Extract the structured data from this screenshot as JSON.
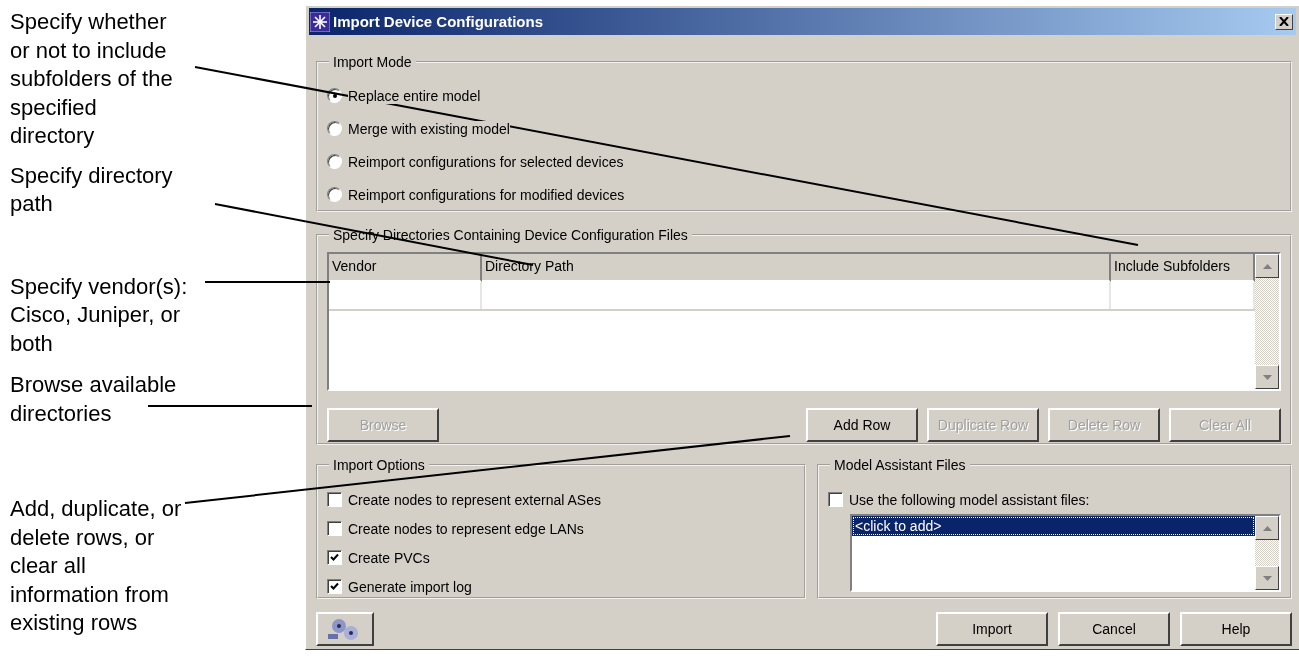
{
  "annotations": [
    {
      "text": "Specify whether\nor not to include\nsubfolders of the\nspecified\ndirectory"
    },
    {
      "text": "Specify directory\npath"
    },
    {
      "text": "Specify vendor(s):\nCisco, Juniper, or\nboth"
    },
    {
      "text": "Browse available\ndirectories"
    },
    {
      "text": "Add, duplicate, or\ndelete rows, or\nclear all\ninformation from\nexisting rows"
    }
  ],
  "window": {
    "title": "Import Device Configurations"
  },
  "import_mode": {
    "legend": "Import Mode",
    "options": [
      {
        "label": "Replace entire model",
        "selected": true
      },
      {
        "label": "Merge with existing model",
        "selected": false
      },
      {
        "label": "Reimport configurations for selected devices",
        "selected": false
      },
      {
        "label": "Reimport configurations for modified devices",
        "selected": false
      }
    ]
  },
  "directories": {
    "legend": "Specify Directories Containing Device Configuration Files",
    "columns": [
      "Vendor",
      "Directory Path",
      "Include Subfolders"
    ],
    "browse_button": {
      "label": "Browse",
      "disabled": true
    },
    "row_buttons": [
      {
        "label": "Add Row",
        "disabled": false
      },
      {
        "label": "Duplicate Row",
        "disabled": true
      },
      {
        "label": "Delete Row",
        "disabled": true
      },
      {
        "label": "Clear All",
        "disabled": true
      }
    ]
  },
  "import_options": {
    "legend": "Import Options",
    "options": [
      {
        "label": "Create nodes to represent external ASes",
        "checked": false
      },
      {
        "label": "Create nodes to represent edge LANs",
        "checked": false
      },
      {
        "label": "Create PVCs",
        "checked": true
      },
      {
        "label": "Generate import log",
        "checked": true
      }
    ]
  },
  "model_assistant": {
    "legend": "Model Assistant Files",
    "checkbox": {
      "label": "Use the following model assistant files:",
      "checked": false
    },
    "files": [
      {
        "label": "<click to add>",
        "selected": true
      }
    ]
  },
  "footer_buttons": [
    {
      "label": "Import"
    },
    {
      "label": "Cancel"
    },
    {
      "label": "Help"
    }
  ]
}
